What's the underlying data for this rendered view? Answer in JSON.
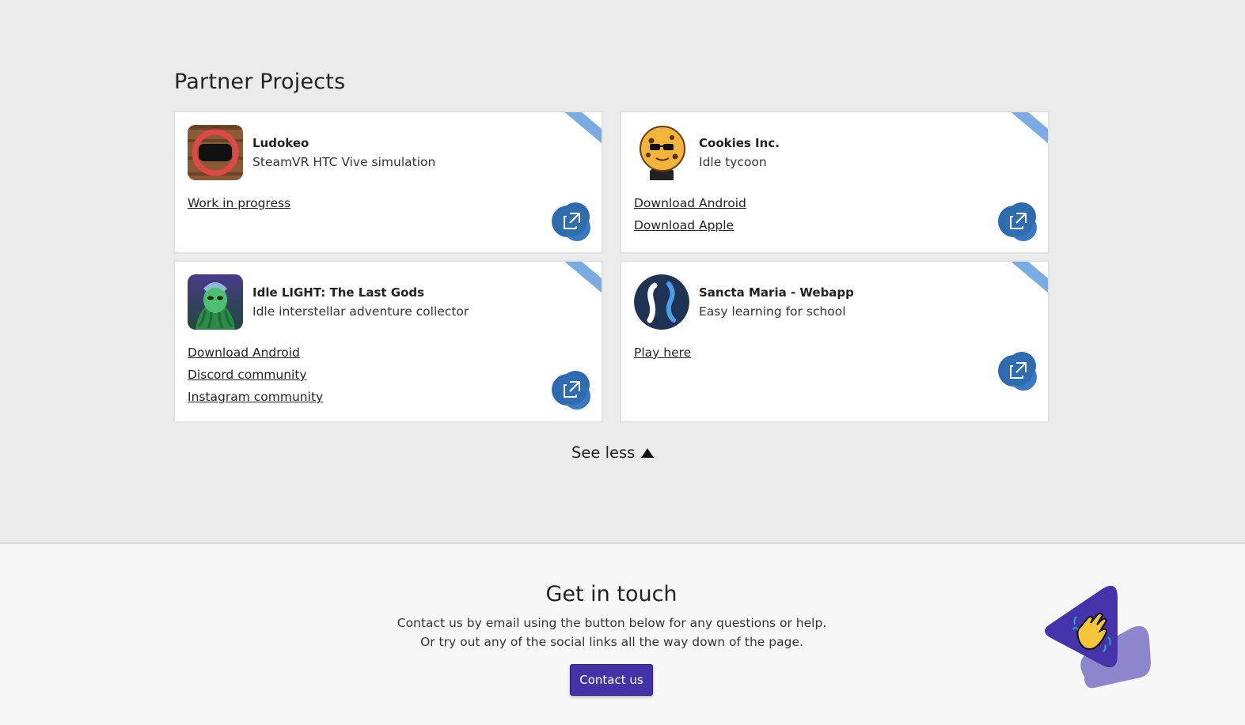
{
  "partners": {
    "title": "Partner Projects",
    "projects": [
      {
        "name": "Ludokeo",
        "description": "SteamVR HTC Vive simulation",
        "thumb_icon": "vr-headset-icon",
        "links": [
          "Work in progress"
        ]
      },
      {
        "name": "Cookies Inc.",
        "description": "Idle tycoon",
        "thumb_icon": "cookie-mascot-icon",
        "links": [
          "Download Android",
          "Download Apple"
        ]
      },
      {
        "name": "Idle LIGHT: The Last Gods",
        "description": "Idle interstellar adventure collector",
        "thumb_icon": "green-deity-icon",
        "links": [
          "Download Android",
          "Discord community",
          "Instagram community"
        ]
      },
      {
        "name": "Sancta Maria - Webapp",
        "description": "Easy learning for school",
        "thumb_icon": "sm-logo-icon",
        "links": [
          "Play here"
        ]
      }
    ],
    "see_less_label": "See less",
    "external_link_icon": "external-link-icon",
    "colors": {
      "ribbon": "#7aace3",
      "ext_button": "#2e6ab0"
    }
  },
  "contact": {
    "title": "Get in touch",
    "text": "Contact us by email using the button below for any questions or help. Or try out any of the social links all the way down of the page.",
    "button_label": "Contact us",
    "decoration_icon": "waving-hand-icon",
    "colors": {
      "button": "#4333a7",
      "triangle_dark": "#4433aa",
      "triangle_light": "#8e86cc"
    }
  }
}
